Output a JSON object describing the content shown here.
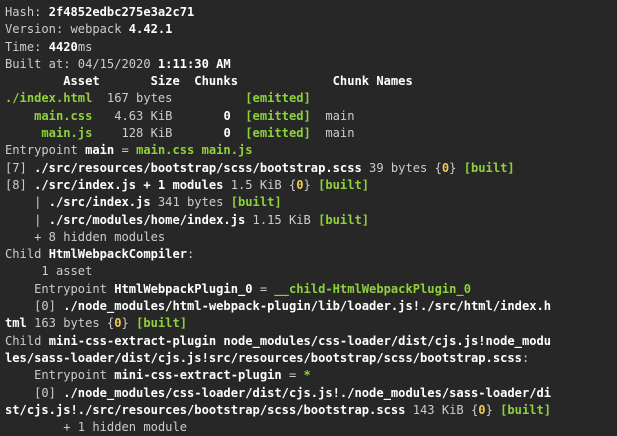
{
  "terminal": {
    "lines": [
      [
        {
          "t": "Hash: ",
          "c": ""
        },
        {
          "t": "2f4852edbc275e3a2c71",
          "c": "b"
        }
      ],
      [
        {
          "t": "Version: webpack ",
          "c": ""
        },
        {
          "t": "4.42.1",
          "c": "b"
        }
      ],
      [
        {
          "t": "Time: ",
          "c": ""
        },
        {
          "t": "4420",
          "c": "b"
        },
        {
          "t": "ms",
          "c": ""
        }
      ],
      [
        {
          "t": "Built at: 04/15/2020 ",
          "c": ""
        },
        {
          "t": "1:11:30 AM",
          "c": "b"
        }
      ],
      [
        {
          "t": "        Asset       Size  Chunks             Chunk Names",
          "c": "b"
        }
      ],
      [
        {
          "t": "./index.html",
          "c": "g"
        },
        {
          "t": "  167 bytes          ",
          "c": ""
        },
        {
          "t": "[emitted]",
          "c": "g"
        }
      ],
      [
        {
          "t": "    main.css",
          "c": "g"
        },
        {
          "t": "   4.63 KiB       ",
          "c": ""
        },
        {
          "t": "0",
          "c": "b"
        },
        {
          "t": "  ",
          "c": ""
        },
        {
          "t": "[emitted]",
          "c": "g"
        },
        {
          "t": "  main",
          "c": ""
        }
      ],
      [
        {
          "t": "     main.js",
          "c": "g"
        },
        {
          "t": "    128 KiB       ",
          "c": ""
        },
        {
          "t": "0",
          "c": "b"
        },
        {
          "t": "  ",
          "c": ""
        },
        {
          "t": "[emitted]",
          "c": "g"
        },
        {
          "t": "  main",
          "c": ""
        }
      ],
      [
        {
          "t": "Entrypoint ",
          "c": ""
        },
        {
          "t": "main",
          "c": "b"
        },
        {
          "t": " = ",
          "c": ""
        },
        {
          "t": "main.css main.js",
          "c": "g"
        }
      ],
      [
        {
          "t": "[7] ",
          "c": ""
        },
        {
          "t": "./src/resources/bootstrap/scss/bootstrap.scss",
          "c": "b"
        },
        {
          "t": " 39 bytes {",
          "c": ""
        },
        {
          "t": "0",
          "c": "y"
        },
        {
          "t": "} ",
          "c": ""
        },
        {
          "t": "[built]",
          "c": "g"
        }
      ],
      [
        {
          "t": "[8] ",
          "c": ""
        },
        {
          "t": "./src/index.js + 1 modules",
          "c": "b"
        },
        {
          "t": " 1.5 KiB {",
          "c": ""
        },
        {
          "t": "0",
          "c": "y"
        },
        {
          "t": "} ",
          "c": ""
        },
        {
          "t": "[built]",
          "c": "g"
        }
      ],
      [
        {
          "t": "    | ",
          "c": ""
        },
        {
          "t": "./src/index.js",
          "c": "b"
        },
        {
          "t": " 341 bytes ",
          "c": ""
        },
        {
          "t": "[built]",
          "c": "g"
        }
      ],
      [
        {
          "t": "    | ",
          "c": ""
        },
        {
          "t": "./src/modules/home/index.js",
          "c": "b"
        },
        {
          "t": " 1.15 KiB ",
          "c": ""
        },
        {
          "t": "[built]",
          "c": "g"
        }
      ],
      [
        {
          "t": "    + 8 hidden modules",
          "c": ""
        }
      ],
      [
        {
          "t": "Child ",
          "c": ""
        },
        {
          "t": "HtmlWebpackCompiler",
          "c": "b"
        },
        {
          "t": ":",
          "c": ""
        }
      ],
      [
        {
          "t": "     1 asset",
          "c": ""
        }
      ],
      [
        {
          "t": "    Entrypoint ",
          "c": ""
        },
        {
          "t": "HtmlWebpackPlugin_0",
          "c": "b"
        },
        {
          "t": " = ",
          "c": ""
        },
        {
          "t": "__child-HtmlWebpackPlugin_0",
          "c": "g"
        }
      ],
      [
        {
          "t": "    [0] ",
          "c": ""
        },
        {
          "t": "./node_modules/html-webpack-plugin/lib/loader.js!./src/html/index.h",
          "c": "b"
        }
      ],
      [
        {
          "t": "tml",
          "c": "b"
        },
        {
          "t": " 163 bytes {",
          "c": ""
        },
        {
          "t": "0",
          "c": "y"
        },
        {
          "t": "} ",
          "c": ""
        },
        {
          "t": "[built]",
          "c": "g"
        }
      ],
      [
        {
          "t": "Child ",
          "c": ""
        },
        {
          "t": "mini-css-extract-plugin node_modules/css-loader/dist/cjs.js!node_modu",
          "c": "b"
        }
      ],
      [
        {
          "t": "les/sass-loader/dist/cjs.js!src/resources/bootstrap/scss/bootstrap.scss",
          "c": "b"
        },
        {
          "t": ":",
          "c": ""
        }
      ],
      [
        {
          "t": "    Entrypoint ",
          "c": ""
        },
        {
          "t": "mini-css-extract-plugin",
          "c": "b"
        },
        {
          "t": " = ",
          "c": ""
        },
        {
          "t": "*",
          "c": "g"
        }
      ],
      [
        {
          "t": "    [0] ",
          "c": ""
        },
        {
          "t": "./node_modules/css-loader/dist/cjs.js!./node_modules/sass-loader/di",
          "c": "b"
        }
      ],
      [
        {
          "t": "st/cjs.js!./src/resources/bootstrap/scss/bootstrap.scss",
          "c": "b"
        },
        {
          "t": " 143 KiB {",
          "c": ""
        },
        {
          "t": "0",
          "c": "y"
        },
        {
          "t": "} ",
          "c": ""
        },
        {
          "t": "[built]",
          "c": "g"
        }
      ],
      [
        {
          "t": "        + 1 hidden module",
          "c": ""
        }
      ]
    ]
  }
}
